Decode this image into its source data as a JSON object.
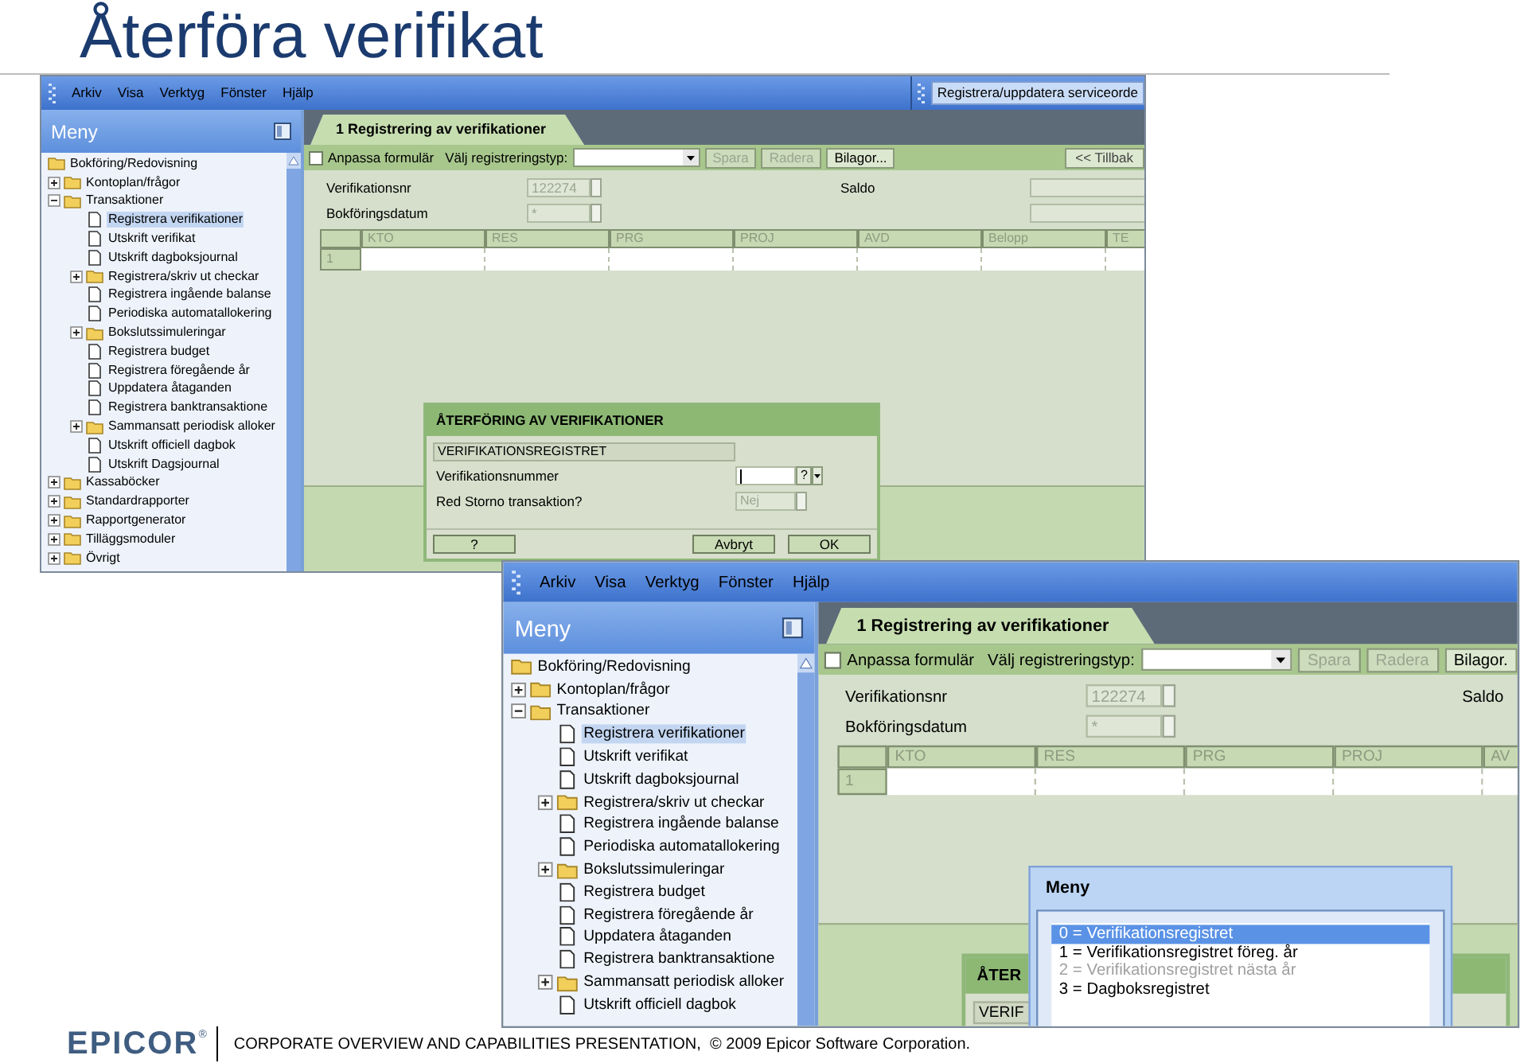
{
  "title": "Återföra verifikat",
  "screenshots": [
    {
      "menu": [
        "Arkiv",
        "Visa",
        "Verktyg",
        "Fönster",
        "Hjälp"
      ],
      "taskbar_item": "Registrera/uppdatera serviceorde",
      "sidebar": {
        "title": "Meny",
        "tree": {
          "label": "Bokföring/Redovisning",
          "kind": "folder",
          "selected": false,
          "children": [
            {
              "label": "Kontoplan/frågor",
              "kind": "folder",
              "expanded": false,
              "selected": false
            },
            {
              "label": "Transaktioner",
              "kind": "folder",
              "expanded": true,
              "selected": false,
              "children": [
                {
                  "label": "Registrera verifikationer",
                  "kind": "document",
                  "selected": true
                },
                {
                  "label": "Utskrift verifikat",
                  "kind": "document",
                  "selected": false
                },
                {
                  "label": "Utskrift dagboksjournal",
                  "kind": "document",
                  "selected": false
                },
                {
                  "label": "Registrera/skriv ut checkar",
                  "kind": "folder",
                  "expanded": false,
                  "selected": false
                },
                {
                  "label": "Registrera ingående balanse",
                  "kind": "document",
                  "selected": false
                },
                {
                  "label": "Periodiska automatallokering",
                  "kind": "document",
                  "selected": false
                },
                {
                  "label": "Bokslutssimuleringar",
                  "kind": "folder",
                  "expanded": false,
                  "selected": false
                },
                {
                  "label": "Registrera budget",
                  "kind": "document",
                  "selected": false
                },
                {
                  "label": "Registrera föregående år",
                  "kind": "document",
                  "selected": false
                },
                {
                  "label": "Uppdatera åtaganden",
                  "kind": "document",
                  "selected": false
                },
                {
                  "label": "Registrera banktransaktione",
                  "kind": "document",
                  "selected": false
                },
                {
                  "label": "Sammansatt periodisk alloker",
                  "kind": "folder",
                  "expanded": false,
                  "selected": false
                },
                {
                  "label": "Utskrift officiell dagbok",
                  "kind": "document",
                  "selected": false
                },
                {
                  "label": "Utskrift Dagsjournal",
                  "kind": "document",
                  "selected": false
                }
              ]
            },
            {
              "label": "Kassaböcker",
              "kind": "folder",
              "expanded": false,
              "selected": false
            },
            {
              "label": "Standardrapporter",
              "kind": "folder",
              "expanded": false,
              "selected": false
            },
            {
              "label": "Rapportgenerator",
              "kind": "folder",
              "expanded": false,
              "selected": false
            },
            {
              "label": "Tilläggsmoduler",
              "kind": "folder",
              "expanded": false,
              "selected": false
            },
            {
              "label": "Övrigt",
              "kind": "folder",
              "expanded": false,
              "selected": false
            }
          ]
        }
      },
      "form": {
        "tab": "1 Registrering av verifikationer",
        "customize": {
          "label": "Anpassa formulär",
          "checked": false
        },
        "type_label": "Välj registreringstyp:",
        "buttons": [
          {
            "label": "Spara",
            "disabled": true
          },
          {
            "label": "Radera",
            "disabled": true
          },
          {
            "label": "Bilagor...",
            "disabled": false
          }
        ],
        "back_button": {
          "label": "<< Tillbak",
          "disabled": false
        },
        "fields": [
          {
            "label": "Verifikationsnr",
            "value": "122274",
            "disabled": true
          },
          {
            "label": "Bokföringsdatum",
            "value": "*",
            "disabled": true
          }
        ],
        "saldo": {
          "label": "Saldo"
        },
        "columns": [
          "KTO",
          "RES",
          "PRG",
          "PROJ",
          "AVD",
          "Belopp",
          "TE"
        ],
        "rows": [
          "1"
        ]
      },
      "dialog": {
        "title": "ÅTERFÖRING AV VERIFIKATIONER",
        "register_label": "VERIFIKATIONSREGISTRET",
        "fields": [
          {
            "label": "Verifikationsnummer",
            "kind": "input",
            "focused": true,
            "help": "?"
          },
          {
            "label": "Red Storno transaktion?",
            "kind": "select",
            "value": "Nej",
            "disabled": true
          }
        ],
        "buttons": [
          "?",
          "Avbryt",
          "OK"
        ]
      }
    },
    {
      "menu": [
        "Arkiv",
        "Visa",
        "Verktyg",
        "Fönster",
        "Hjälp"
      ],
      "sidebar": {
        "title": "Meny",
        "tree": {
          "label": "Bokföring/Redovisning",
          "kind": "folder",
          "selected": false,
          "children": [
            {
              "label": "Kontoplan/frågor",
              "kind": "folder",
              "expanded": false,
              "selected": false
            },
            {
              "label": "Transaktioner",
              "kind": "folder",
              "expanded": true,
              "selected": false,
              "children": [
                {
                  "label": "Registrera verifikationer",
                  "kind": "document",
                  "selected": true
                },
                {
                  "label": "Utskrift verifikat",
                  "kind": "document",
                  "selected": false
                },
                {
                  "label": "Utskrift dagboksjournal",
                  "kind": "document",
                  "selected": false
                },
                {
                  "label": "Registrera/skriv ut checkar",
                  "kind": "folder",
                  "expanded": false,
                  "selected": false
                },
                {
                  "label": "Registrera ingående balanse",
                  "kind": "document",
                  "selected": false
                },
                {
                  "label": "Periodiska automatallokering",
                  "kind": "document",
                  "selected": false
                },
                {
                  "label": "Bokslutssimuleringar",
                  "kind": "folder",
                  "expanded": false,
                  "selected": false
                },
                {
                  "label": "Registrera budget",
                  "kind": "document",
                  "selected": false
                },
                {
                  "label": "Registrera föregående år",
                  "kind": "document",
                  "selected": false
                },
                {
                  "label": "Uppdatera åtaganden",
                  "kind": "document",
                  "selected": false
                },
                {
                  "label": "Registrera banktransaktione",
                  "kind": "document",
                  "selected": false
                },
                {
                  "label": "Sammansatt periodisk alloker",
                  "kind": "folder",
                  "expanded": false,
                  "selected": false
                },
                {
                  "label": "Utskrift officiell dagbok",
                  "kind": "document",
                  "selected": false
                }
              ]
            }
          ]
        }
      },
      "form": {
        "tab": "1 Registrering av verifikationer",
        "customize": {
          "label": "Anpassa formulär",
          "checked": false
        },
        "type_label": "Välj registreringstyp:",
        "buttons": [
          {
            "label": "Spara",
            "disabled": true
          },
          {
            "label": "Radera",
            "disabled": true
          },
          {
            "label": "Bilagor.",
            "disabled": false
          }
        ],
        "fields": [
          {
            "label": "Verifikationsnr",
            "value": "122274",
            "disabled": true
          },
          {
            "label": "Bokföringsdatum",
            "value": "*",
            "disabled": true
          }
        ],
        "saldo": {
          "label": "Saldo"
        },
        "columns": [
          "KTO",
          "RES",
          "PRG",
          "PROJ",
          "AV"
        ],
        "rows": [
          "1"
        ]
      },
      "dialog": {
        "title": "ÅTER",
        "register_label": "VERIF"
      },
      "popup": {
        "title": "Meny",
        "items": [
          {
            "label": "0 = Verifikationsregistret",
            "selected": true,
            "disabled": false
          },
          {
            "label": "1 = Verifikationsregistret föreg. år",
            "selected": false,
            "disabled": false
          },
          {
            "label": "2 = Verifikationsregistret nästa år",
            "selected": false,
            "disabled": true
          },
          {
            "label": "3 = Dagboksregistret",
            "selected": false,
            "disabled": false
          }
        ]
      }
    }
  ],
  "footer": {
    "logo": "EPICOR",
    "logo_mark": "®",
    "text": "CORPORATE OVERVIEW AND CAPABILITIES PRESENTATION,  © 2009 Epicor Software Corporation."
  }
}
